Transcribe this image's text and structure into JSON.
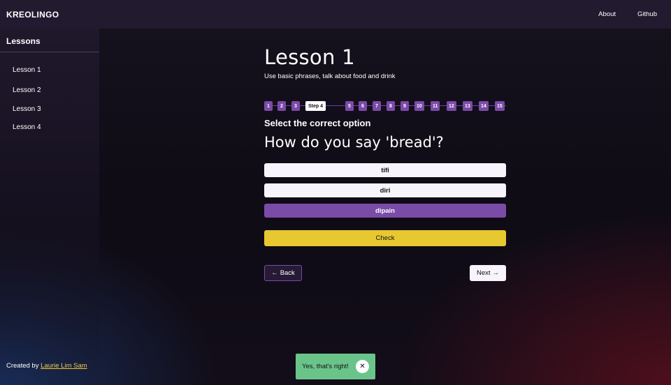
{
  "header": {
    "brand": "KREOLINGO",
    "nav": [
      "About",
      "Github"
    ]
  },
  "sidebar": {
    "title": "Lessons",
    "items": [
      "Lesson 1",
      "Lesson 2",
      "Lesson 3",
      "Lesson 4"
    ],
    "credit_prefix": "Created by ",
    "credit_author": "Laurie Lim Sam"
  },
  "lesson": {
    "title": "Lesson 1",
    "subtitle": "Use basic phrases, talk about food and drink",
    "steps": [
      "1",
      "2",
      "3",
      "Step 4",
      "5",
      "6",
      "7",
      "8",
      "9",
      "10",
      "11",
      "12",
      "13",
      "14",
      "15"
    ],
    "current_step": 4,
    "instruction": "Select the correct option",
    "question": "How do you say 'bread'?",
    "options": [
      "tifi",
      "diri",
      "dipain"
    ],
    "selected_option": "dipain",
    "check_label": "Check",
    "back_label": "Back",
    "next_label": "Next",
    "back_arrow": "←",
    "next_arrow": "→"
  },
  "toast": {
    "message": "Yes, that's right!",
    "close_glyph": "✕"
  },
  "colors": {
    "accent": "#7b4ba8",
    "check": "#e8c830",
    "success": "#6ac48a",
    "link": "#f0c93a"
  }
}
